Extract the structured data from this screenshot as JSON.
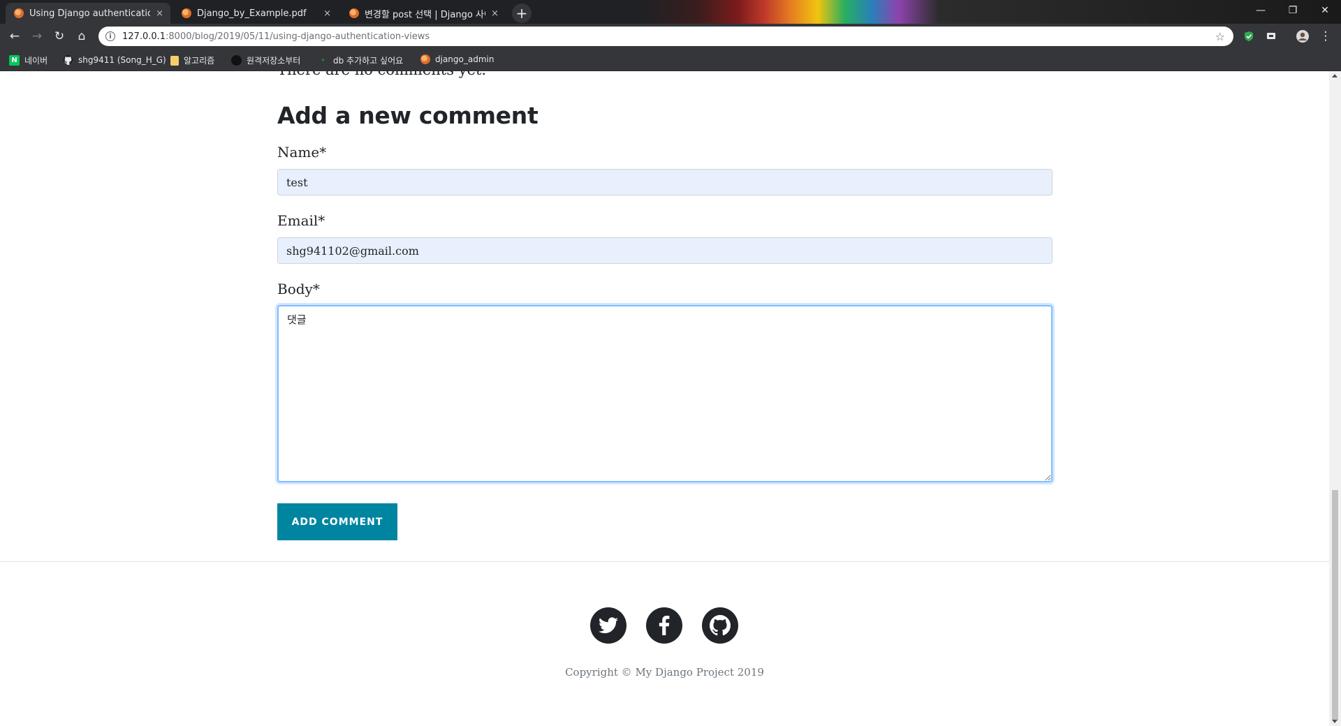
{
  "browser": {
    "tabs": [
      {
        "title": "Using Django authentication vie",
        "close": "×",
        "active": true
      },
      {
        "title": "Django_by_Example.pdf",
        "close": "×",
        "active": false
      },
      {
        "title": "변경할 post 선택 | Django 사이",
        "close": "×",
        "active": false
      }
    ],
    "new_tab_label": "+",
    "window_controls": {
      "minimize": "—",
      "restore": "❐",
      "close": "✕"
    },
    "nav": {
      "back": "←",
      "forward": "→",
      "reload": "↻",
      "home": "⌂"
    },
    "url_host": "127.0.0.1",
    "url_path": ":8000/blog/2019/05/11/using-django-authentication-views",
    "info_icon": "i",
    "bookmark_star": "☆",
    "menu_dots": "⋮",
    "bookmarks": [
      {
        "label": "네이버",
        "icon": "naver-icon",
        "glyph": "N",
        "color": "#03c75a"
      },
      {
        "label": "shg9411 (Song_H_G)",
        "icon": "github-icon",
        "glyph": "●",
        "color": "#e8eaed"
      },
      {
        "label": "알고리즘",
        "icon": "folder-icon",
        "glyph": "",
        "color": "#f6cf6b"
      },
      {
        "label": "원격저장소부터",
        "icon": "circle-icon",
        "glyph": "●",
        "color": "#111111"
      },
      {
        "label": "db 추가하고 싶어요",
        "icon": "leaf-icon",
        "glyph": "✦",
        "color": "#2e7d32"
      },
      {
        "label": "django_admin",
        "icon": "django-icon",
        "glyph": "",
        "color": "#e06c2a"
      }
    ]
  },
  "page": {
    "no_comments": "There are no comments yet.",
    "form_title": "Add a new comment",
    "fields": {
      "name": {
        "label": "Name*",
        "value": "test"
      },
      "email": {
        "label": "Email*",
        "value": "shg941102@gmail.com"
      },
      "body": {
        "label": "Body*",
        "value": "댓글"
      }
    },
    "submit_label": "ADD COMMENT",
    "social": [
      {
        "name": "twitter-icon"
      },
      {
        "name": "facebook-icon"
      },
      {
        "name": "github-icon"
      }
    ],
    "copyright": "Copyright © My Django Project 2019"
  },
  "colors": {
    "primary_button": "#0085a1",
    "autofill_bg": "#e8f0fe",
    "focus_border": "#80bdff",
    "social_circle": "#212529"
  }
}
